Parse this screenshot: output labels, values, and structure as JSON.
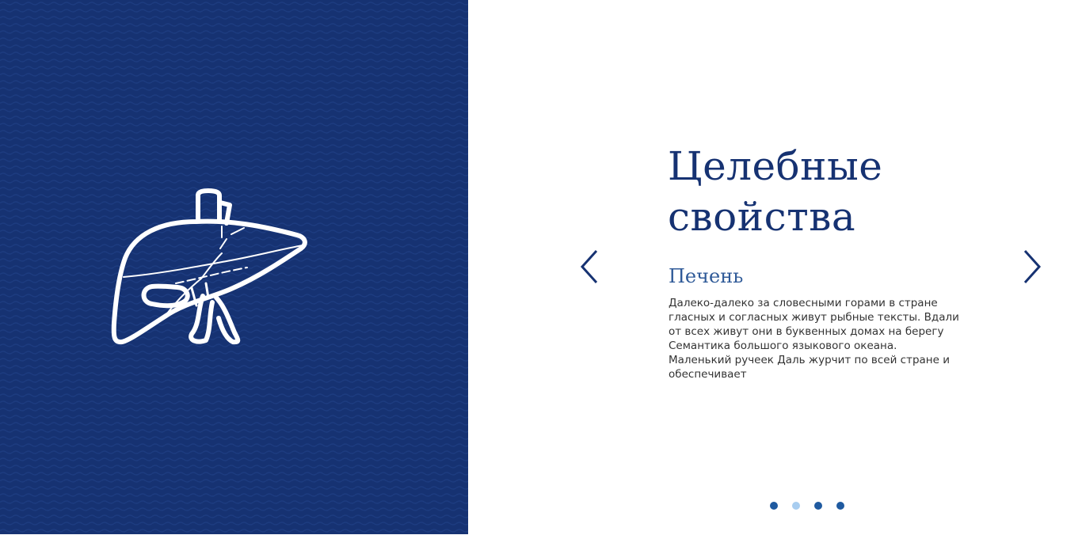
{
  "colors": {
    "panel_background": "#163272",
    "panel_wave": "#1d3c80",
    "title": "#163272",
    "subtitle": "#2f5a98",
    "text": "#333333",
    "dot": "#1f5aa0",
    "dot_active": "#a8cdf0",
    "illustration_stroke": "#ffffff"
  },
  "illustration": {
    "icon": "liver-icon"
  },
  "slide": {
    "title": "Целебные свойства",
    "subtitle": "Печень",
    "text": "Далеко-далеко за словесными горами в стране гласных и согласных живут рыбные тексты. Вдали от всех живут они в буквенных домах на берегу Семантика большого языкового океана. Маленький ручеек Даль журчит по всей стране и обеспечивает"
  },
  "navigation": {
    "prev_icon": "chevron-left-icon",
    "next_icon": "chevron-right-icon"
  },
  "pagination": {
    "count": 4,
    "active_index": 1
  }
}
